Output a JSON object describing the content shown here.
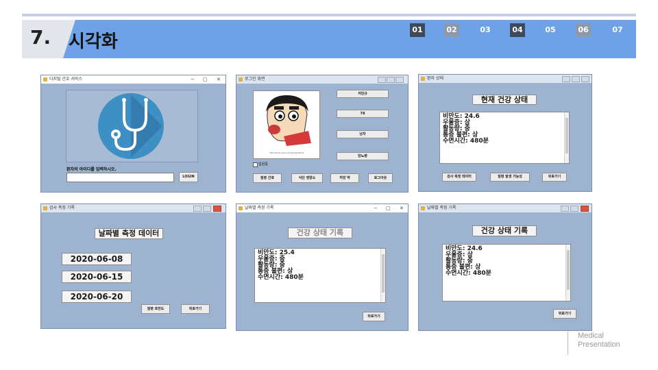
{
  "slide": {
    "number": "7.",
    "title": "시각화",
    "tabs": [
      "01",
      "02",
      "03",
      "04",
      "05",
      "06",
      "07"
    ],
    "footer_line1": "Medical",
    "footer_line2": "Presentation"
  },
  "colors": {
    "accent": "#6fa1e8",
    "window_bg": "#9eb3cf",
    "tab_dark": "#3e4a5a",
    "tab_gray": "#8c99a8"
  },
  "login_window": {
    "title": "디지털 간호 서비스",
    "controls": [
      "−",
      "□",
      "✕"
    ],
    "prompt": "환자의 아이디를 입력하시오.",
    "id_value": "",
    "login_button": "LOGIN",
    "logo_icon": "stethoscope-icon"
  },
  "patient_window": {
    "title": "로그인 화면",
    "name_value": "석민규",
    "weight_value": "78",
    "gender_value": "남자",
    "disease_value": "당뇨병",
    "hospitalized_label": "입원중",
    "image_caption": "http://blog.naver.com/girlgirlbirds",
    "photo_icon": "cartoon-character-photo",
    "buttons": [
      "질병 간호",
      "식단 영양소",
      "처방 약",
      "로그아웃"
    ]
  },
  "health_window": {
    "title": "환자 상태",
    "heading": "현재 건강 상태",
    "lines": [
      "비만도: 24.6",
      "우울증: 상",
      "활동량: 중",
      "통증 불편: 상",
      "수면시간: 480분"
    ],
    "buttons": [
      "검사 측정 데이터",
      "질병 발생 가능성",
      "뒤로가기"
    ]
  },
  "dates_window": {
    "title": "검사 측정 기록",
    "heading": "날짜별 측정 데이터",
    "dates": [
      "2020-06-08",
      "2020-06-15",
      "2020-06-20"
    ],
    "buttons": [
      "질병 호전도",
      "뒤로가기"
    ]
  },
  "record_window_1": {
    "title": "날짜별 측정 기록",
    "controls": [
      "−",
      "□",
      "✕"
    ],
    "heading": "건강 상태 기록",
    "lines": [
      "비만도: 25.4",
      "우울증: 중",
      "활동량: 중",
      "통증 불편: 상",
      "수면시간: 480분"
    ],
    "back_button": "뒤로가기"
  },
  "record_window_2": {
    "title": "날짜별 측정 기록",
    "heading": "건강 상태 기록",
    "lines": [
      "비만도: 24.6",
      "우울증: 상",
      "활동량: 중",
      "통증 불편: 상",
      "수면시간: 480분"
    ],
    "back_button": "뒤로가기"
  }
}
